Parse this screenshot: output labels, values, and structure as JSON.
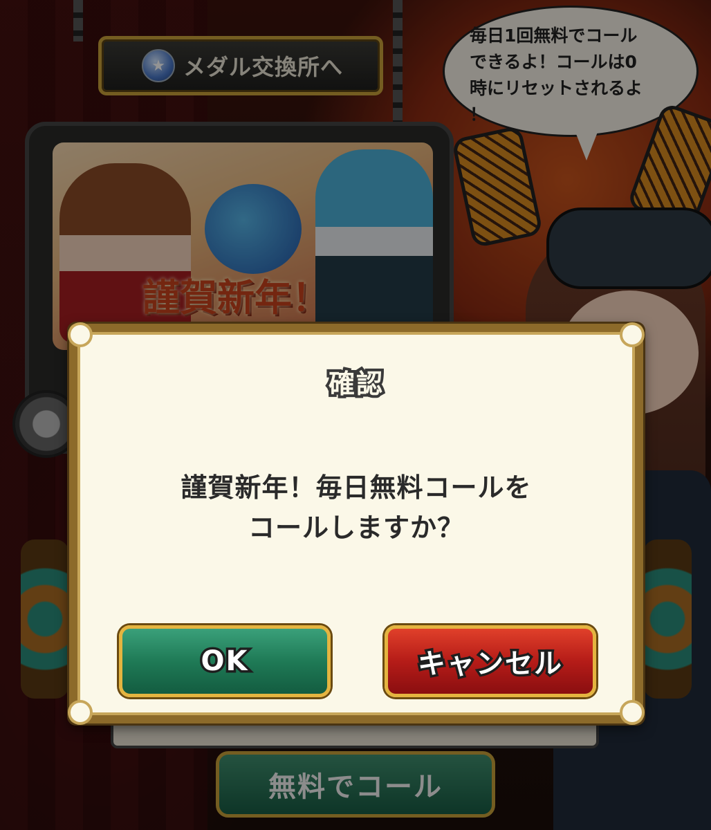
{
  "background": {
    "medal_exchange_label": "メダル交換所へ",
    "speech_bubble": "毎日1回無料でコール\nできるよ！コールは0\n時にリセットされるよ\n！",
    "banner_title": "謹賀新年！",
    "free_call_button_label": "無料でコール"
  },
  "dialog": {
    "title": "確認",
    "message": "謹賀新年！毎日無料コールを\nコールしますか？",
    "ok_label": "OK",
    "cancel_label": "キャンセル"
  },
  "colors": {
    "ok_button": "#1f7a56",
    "cancel_button": "#b51c18",
    "dialog_bg": "#fbf8e8",
    "frame_gold": "#c7a65a"
  }
}
